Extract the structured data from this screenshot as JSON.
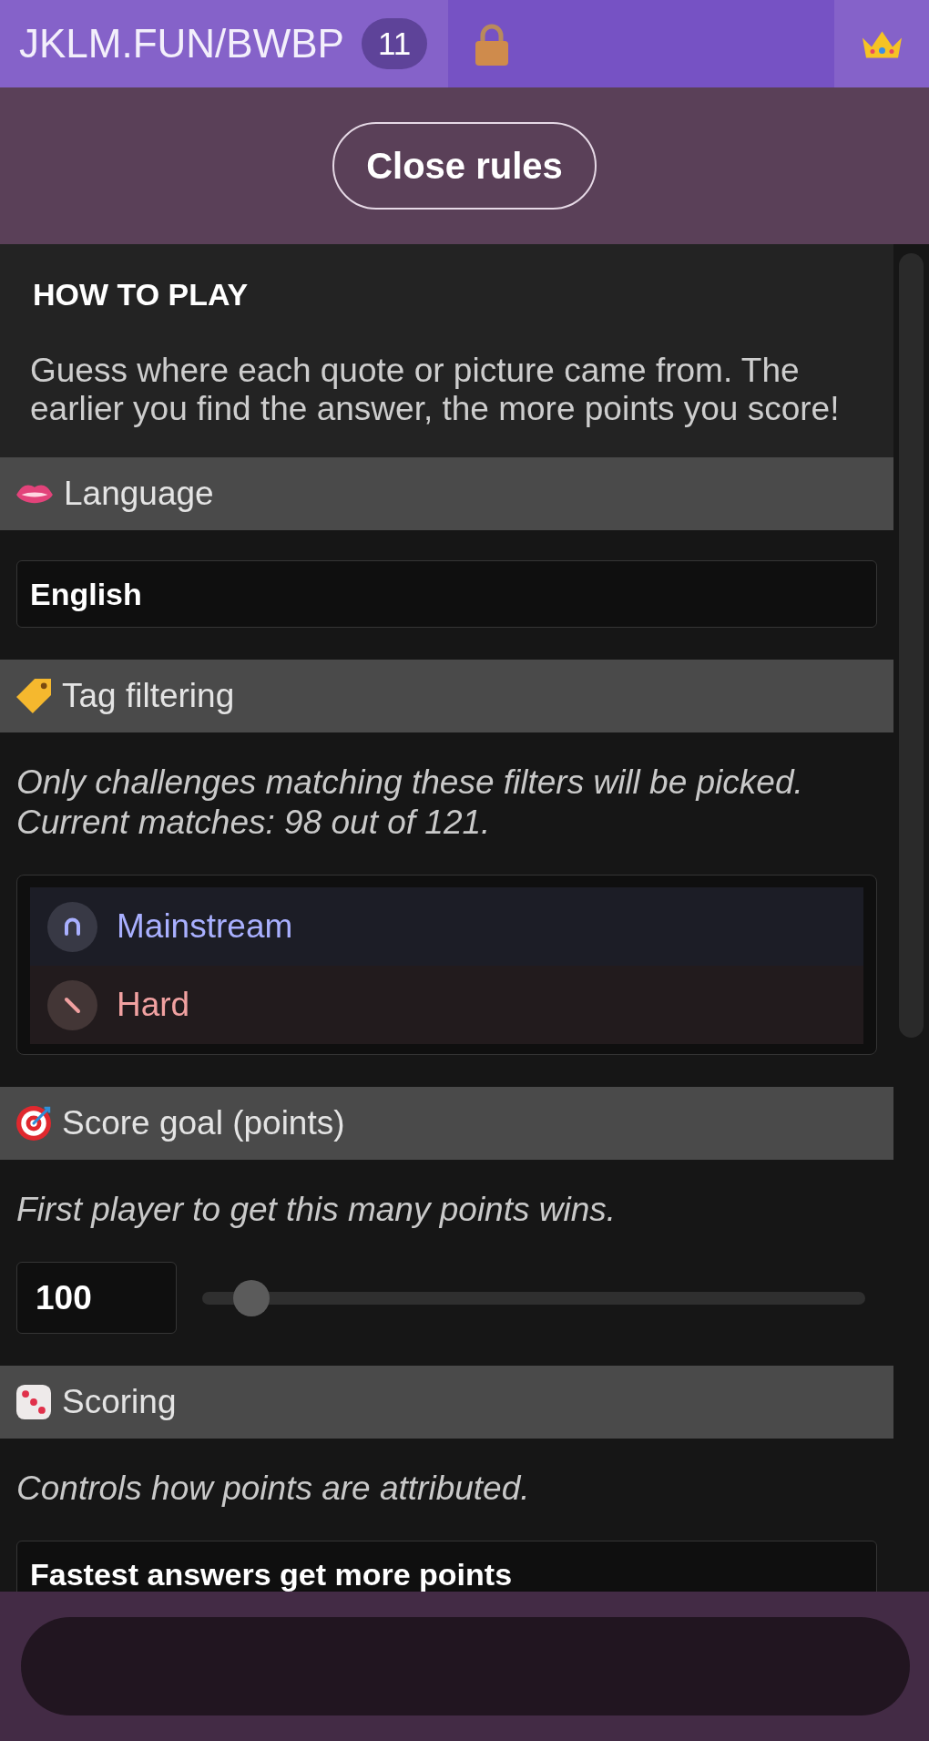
{
  "top_bar": {
    "room_link": "JKLM.FUN/BWBP",
    "player_count": "11"
  },
  "close_rules_button": {
    "label": "Close rules"
  },
  "how_to_play": {
    "title": "HOW TO PLAY",
    "text": "Guess where each quote or picture came from. The earlier you find the answer, the more points you score!"
  },
  "sections": [
    {
      "kind": "select",
      "title": "Language",
      "value": "English"
    },
    {
      "kind": "tags",
      "title": "Tag filtering",
      "description": "Only challenges matching these filters will be picked. Current matches: 98 out of 121.",
      "tags": [
        {
          "label": "Mainstream",
          "color": "#a9b0ff"
        },
        {
          "label": "Hard",
          "color": "#f1a1a1"
        }
      ]
    },
    {
      "kind": "slider",
      "title": "Score goal (points)",
      "description": "First player to get this many points wins.",
      "value": "100",
      "level": 0.05
    },
    {
      "kind": "select",
      "title": "Scoring",
      "description": "Controls how points are attributed.",
      "value": "Fastest answers get more points"
    }
  ]
}
